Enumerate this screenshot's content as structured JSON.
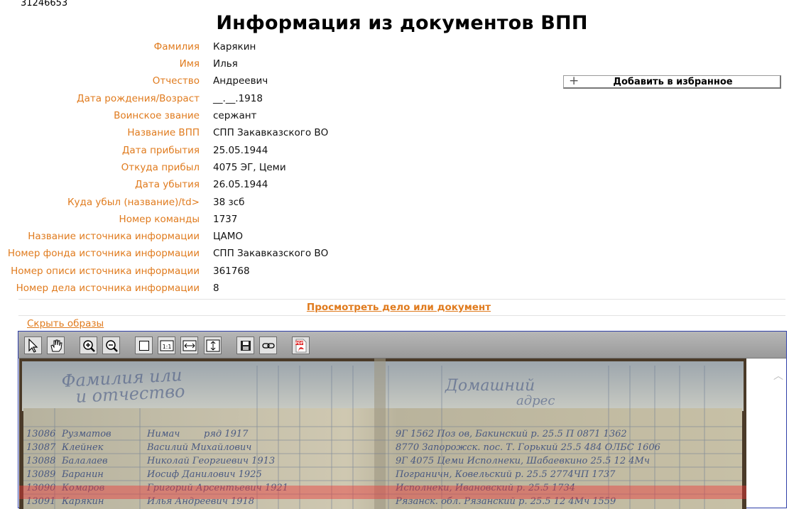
{
  "record_id": "31246653",
  "title": "Информация из документов ВПП",
  "fields": [
    {
      "label": "Фамилия",
      "value": "Карякин"
    },
    {
      "label": "Имя",
      "value": "Илья"
    },
    {
      "label": "Отчество",
      "value": "Андреевич"
    },
    {
      "label": "Дата рождения/Возраст",
      "value": "__.__.1918"
    },
    {
      "label": "Воинское звание",
      "value": "сержант"
    },
    {
      "label": "Название ВПП",
      "value": "СПП Закавказского ВО"
    },
    {
      "label": "Дата прибытия",
      "value": "25.05.1944"
    },
    {
      "label": "Откуда прибыл",
      "value": "4075 ЭГ, Цеми"
    },
    {
      "label": "Дата убытия",
      "value": "26.05.1944"
    },
    {
      "label": "Куда убыл (название)/td>",
      "value": "38 зсб"
    },
    {
      "label": "Номер команды",
      "value": "1737"
    },
    {
      "label": "Название источника информации",
      "value": "ЦАМО"
    },
    {
      "label": "Номер фонда источника информации",
      "value": "СПП Закавказского ВО"
    },
    {
      "label": "Номер описи источника информации",
      "value": "361768"
    },
    {
      "label": "Номер дела источника информации",
      "value": "8"
    }
  ],
  "favorite_button": {
    "label": "Добавить в избранное",
    "icon": "plus-icon"
  },
  "view_document_link": "Просмотреть дело или документ",
  "hide_images_link": "Скрыть образы",
  "viewer_toolbar": [
    {
      "name": "select-tool-button",
      "icon": "pointer-icon"
    },
    {
      "name": "pan-tool-button",
      "icon": "hand-icon"
    },
    {
      "name": "zoom-in-button",
      "icon": "zoom-in-icon"
    },
    {
      "name": "zoom-out-button",
      "icon": "zoom-out-icon"
    },
    {
      "name": "fit-page-button",
      "icon": "page-icon"
    },
    {
      "name": "actual-size-button",
      "icon": "one-to-one-icon"
    },
    {
      "name": "fit-width-button",
      "icon": "fit-width-icon"
    },
    {
      "name": "fit-height-button",
      "icon": "fit-height-icon"
    },
    {
      "name": "save-button",
      "icon": "floppy-icon"
    },
    {
      "name": "link-button",
      "icon": "link-icon"
    },
    {
      "name": "pdf-button",
      "icon": "pdf-icon"
    }
  ],
  "colors": {
    "label": "#e07b1e",
    "link": "#e07b1e",
    "viewer_border": "#2f3fa8",
    "highlight": "#eb3737"
  }
}
